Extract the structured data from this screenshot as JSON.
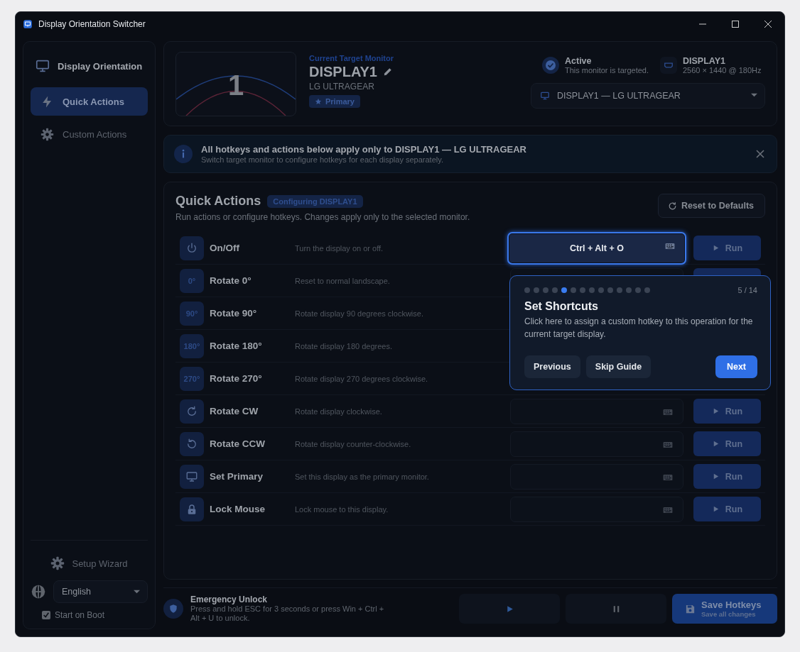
{
  "window": {
    "title": "Display Orientation Switcher"
  },
  "sidebar": {
    "brand": "Display Orientation",
    "items": [
      {
        "label": "Quick Actions",
        "kind": "bolt",
        "selected": true
      },
      {
        "label": "Custom Actions",
        "kind": "gear",
        "selected": false
      }
    ],
    "setup_wizard": "Setup Wizard",
    "language": "English",
    "start_on_boot": {
      "label": "Start on Boot",
      "checked": true
    }
  },
  "monitor": {
    "preview_number": "1",
    "caption": "Current Target Monitor",
    "name": "DISPLAY1",
    "model": "LG ULTRAGEAR",
    "badge": "Primary",
    "status": {
      "title": "Active",
      "text": "This monitor is targeted."
    },
    "display": {
      "name": "DISPLAY1",
      "mode": "2560 × 1440 @ 180Hz"
    },
    "selector": "DISPLAY1 — LG ULTRAGEAR"
  },
  "banner": {
    "title": "All hotkeys and actions below apply only to DISPLAY1 — LG ULTRAGEAR",
    "text": "Switch target monitor to configure hotkeys for each display separately."
  },
  "quick_actions": {
    "title": "Quick Actions",
    "badge": "Configuring DISPLAY1",
    "subtitle": "Run actions or configure hotkeys. Changes apply only to the selected monitor.",
    "reset": "Reset to Defaults",
    "rows": [
      {
        "kind": "power",
        "name": "On/Off",
        "description": "Turn the display on or off.",
        "hotkey": "Ctrl + Alt + O",
        "focused": true,
        "run": "Run"
      },
      {
        "badge": "0°",
        "name": "Rotate 0°",
        "description": "Reset to normal landscape.",
        "focused": false
      },
      {
        "badge": "90°",
        "name": "Rotate 90°",
        "description": "Rotate display 90 degrees clockwise."
      },
      {
        "badge": "180°",
        "name": "Rotate 180°",
        "description": "Rotate display 180 degrees."
      },
      {
        "badge": "270°",
        "name": "Rotate 270°",
        "description": "Rotate display 270 degrees clockwise."
      },
      {
        "kind": "rotate-cw",
        "name": "Rotate CW",
        "description": "Rotate display clockwise.",
        "focused": false,
        "run": "Run"
      },
      {
        "kind": "rotate-ccw",
        "name": "Rotate CCW",
        "description": "Rotate display counter-clockwise.",
        "focused": false,
        "run": "Run"
      },
      {
        "kind": "monitor",
        "name": "Set Primary",
        "description": "Set this display as the primary monitor.",
        "focused": false,
        "run": "Run"
      },
      {
        "kind": "lock",
        "name": "Lock Mouse",
        "description": "Lock mouse to this display.",
        "focused": false,
        "run": "Run"
      }
    ]
  },
  "guide": {
    "steps": [
      {
        "selected": false
      },
      {
        "selected": false
      },
      {
        "selected": false
      },
      {
        "selected": false
      },
      {
        "selected": true
      },
      {
        "selected": false
      },
      {
        "selected": false
      },
      {
        "selected": false
      },
      {
        "selected": false
      },
      {
        "selected": false
      },
      {
        "selected": false
      },
      {
        "selected": false
      },
      {
        "selected": false
      },
      {
        "selected": false
      }
    ],
    "counter": "5 / 14",
    "title": "Set Shortcuts",
    "text": "Click here to assign a custom hotkey to this operation for the current target display.",
    "buttons": [
      "Previous",
      "Skip Guide"
    ],
    "primary": "Next"
  },
  "footer": {
    "title": "Emergency Unlock",
    "text": "Press and hold ESC for 3 seconds or press Win + Ctrl + Alt + U to unlock.",
    "save": "Save Hotkeys",
    "save_hint": "Save all changes"
  }
}
